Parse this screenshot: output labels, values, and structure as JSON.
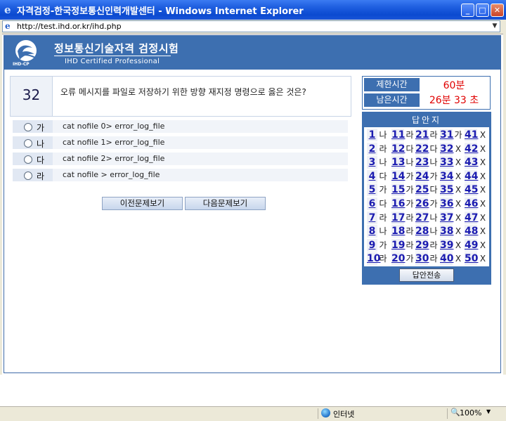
{
  "window": {
    "title": "자격검정-한국정보통신인력개발센터 - Windows Internet Explorer",
    "address": "http://test.ihd.or.kr/ihd.php",
    "colors": {
      "header": "#3d6fb0",
      "time": "#e00000"
    }
  },
  "header": {
    "logo_text": "IHD-CP",
    "title": "정보통신기술자격 검정시험",
    "subtitle": "IHD Certified Professional"
  },
  "question": {
    "number": "32",
    "text": "오류 메시지를 파일로 저장하기 위한 방향 재지정 명령으로 옳은 것은?",
    "options": [
      {
        "letter": "가",
        "text": "cat nofile 0> error_log_file"
      },
      {
        "letter": "나",
        "text": "cat nofile 1> error_log_file"
      },
      {
        "letter": "다",
        "text": "cat nofile 2> error_log_file"
      },
      {
        "letter": "라",
        "text": "cat nofile > error_log_file"
      }
    ]
  },
  "buttons": {
    "prev": "이전문제보기",
    "next": "다음문제보기",
    "submit": "답안전송"
  },
  "timer": {
    "limit_label": "제한시간",
    "limit_value": "60분",
    "remain_label": "남은시간",
    "remain_value": "26분 33 초"
  },
  "answer_sheet": {
    "title": "답안지",
    "rows": [
      [
        {
          "n": "1",
          "a": "나"
        },
        {
          "n": "11",
          "a": "라"
        },
        {
          "n": "21",
          "a": "라"
        },
        {
          "n": "31",
          "a": "가"
        },
        {
          "n": "41",
          "a": "X"
        }
      ],
      [
        {
          "n": "2",
          "a": "라"
        },
        {
          "n": "12",
          "a": "다"
        },
        {
          "n": "22",
          "a": "다"
        },
        {
          "n": "32",
          "a": "X"
        },
        {
          "n": "42",
          "a": "X"
        }
      ],
      [
        {
          "n": "3",
          "a": "나"
        },
        {
          "n": "13",
          "a": "나"
        },
        {
          "n": "23",
          "a": "나"
        },
        {
          "n": "33",
          "a": "X"
        },
        {
          "n": "43",
          "a": "X"
        }
      ],
      [
        {
          "n": "4",
          "a": "다"
        },
        {
          "n": "14",
          "a": "가"
        },
        {
          "n": "24",
          "a": "가"
        },
        {
          "n": "34",
          "a": "X"
        },
        {
          "n": "44",
          "a": "X"
        }
      ],
      [
        {
          "n": "5",
          "a": "가"
        },
        {
          "n": "15",
          "a": "가"
        },
        {
          "n": "25",
          "a": "다"
        },
        {
          "n": "35",
          "a": "X"
        },
        {
          "n": "45",
          "a": "X"
        }
      ],
      [
        {
          "n": "6",
          "a": "다"
        },
        {
          "n": "16",
          "a": "가"
        },
        {
          "n": "26",
          "a": "가"
        },
        {
          "n": "36",
          "a": "X"
        },
        {
          "n": "46",
          "a": "X"
        }
      ],
      [
        {
          "n": "7",
          "a": "라"
        },
        {
          "n": "17",
          "a": "라"
        },
        {
          "n": "27",
          "a": "나"
        },
        {
          "n": "37",
          "a": "X"
        },
        {
          "n": "47",
          "a": "X"
        }
      ],
      [
        {
          "n": "8",
          "a": "나"
        },
        {
          "n": "18",
          "a": "라"
        },
        {
          "n": "28",
          "a": "나"
        },
        {
          "n": "38",
          "a": "X"
        },
        {
          "n": "48",
          "a": "X"
        }
      ],
      [
        {
          "n": "9",
          "a": "가"
        },
        {
          "n": "19",
          "a": "라"
        },
        {
          "n": "29",
          "a": "라"
        },
        {
          "n": "39",
          "a": "X"
        },
        {
          "n": "49",
          "a": "X"
        }
      ],
      [
        {
          "n": "10",
          "a": "라"
        },
        {
          "n": "20",
          "a": "가"
        },
        {
          "n": "30",
          "a": "라"
        },
        {
          "n": "40",
          "a": "X"
        },
        {
          "n": "50",
          "a": "X"
        }
      ]
    ]
  },
  "statusbar": {
    "zone": "인터넷",
    "zoom": "100%"
  }
}
